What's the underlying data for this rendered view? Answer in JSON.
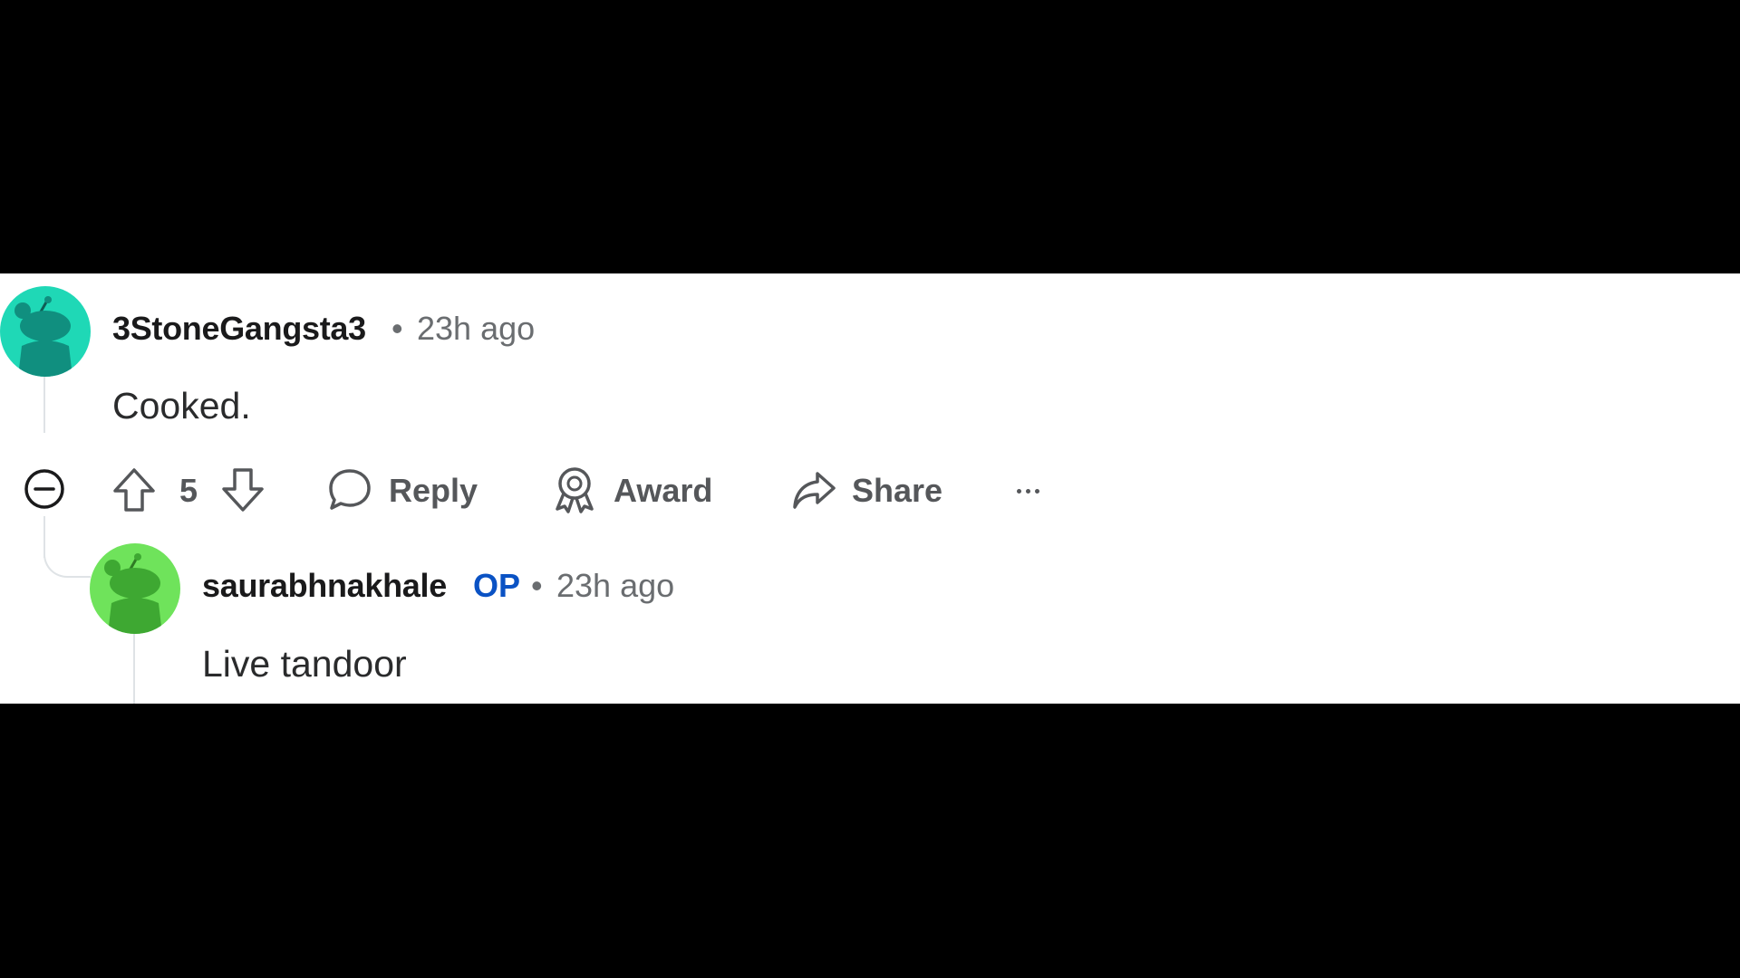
{
  "comment": {
    "username": "3StoneGangsta3",
    "separator": "•",
    "time": "23h ago",
    "body": "Cooked.",
    "avatar_color": "#1fd8b6",
    "avatar_icon": "reddit-snoo-avatar-icon"
  },
  "actions": {
    "collapse_icon": "minus-circle-icon",
    "score": "5",
    "reply_label": "Reply",
    "award_label": "Award",
    "share_label": "Share",
    "more_icon": "ellipsis-icon"
  },
  "reply": {
    "username": "saurabhnakhale",
    "op_badge": "OP",
    "op_color": "#0a52c4",
    "separator": "•",
    "time": "23h ago",
    "body": "Live tandoor",
    "avatar_color": "#6fe35b",
    "avatar_icon": "reddit-snoo-avatar-icon"
  }
}
